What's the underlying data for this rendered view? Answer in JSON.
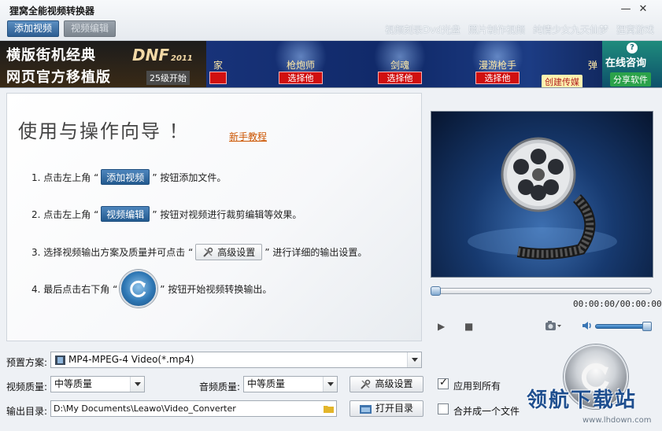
{
  "app": {
    "title": "狸窝全能视频转换器"
  },
  "window_controls": {
    "minimize": "—",
    "close": "✕"
  },
  "toolbar": {
    "add_video": "添加视频",
    "edit_video": "视频编辑"
  },
  "top_links": [
    "视频刻录Dvd光盘",
    "照片制作视频",
    "纯情少女九天仙梦",
    "狸窝游戏"
  ],
  "banner": {
    "line1": "横版街机经典",
    "line2": "网页官方移植版",
    "dnf": "DNF",
    "dnf_year": "2011",
    "level": "25级开始",
    "chars": [
      "家",
      "枪炮师",
      "剑魂",
      "漫游枪手",
      "弹"
    ],
    "pick": "选择他",
    "chuang": "创建传媒",
    "consult": "在线咨询",
    "share": "分享软件",
    "help": "?"
  },
  "wizard": {
    "title": "使用与操作向导 ！",
    "tutorial_link": "新手教程",
    "step1_pre": "1. 点击左上角 “",
    "step1_btn": "添加视频",
    "step1_post": "” 按钮添加文件。",
    "step2_pre": "2. 点击左上角 “",
    "step2_btn": "视频编辑",
    "step2_post": "” 按钮对视频进行裁剪编辑等效果。",
    "step3_pre": "3. 选择视频输出方案及质量并可点击 “",
    "step3_btn": "高级设置",
    "step3_post": "” 进行详细的输出设置。",
    "step4_pre": "4. 最后点击右下角 “",
    "step4_post": "” 按钮开始视频转换输出。"
  },
  "player": {
    "timecode": "00:00:00/00:00:00"
  },
  "settings": {
    "preset_label": "预置方案:",
    "preset_value": "MP4-MPEG-4 Video(*.mp4)",
    "video_quality_label": "视频质量:",
    "video_quality_value": "中等质量",
    "audio_quality_label": "音频质量:",
    "audio_quality_value": "中等质量",
    "advanced_button": "高级设置",
    "apply_all_label": "应用到所有",
    "output_dir_label": "输出目录:",
    "output_dir_value": "D:\\My Documents\\Leawo\\Video_Converter",
    "open_dir_button": "打开目录",
    "merge_label": "合并成一个文件"
  },
  "watermark": {
    "brand": "领航下载站",
    "url": "www.lhdown.com"
  },
  "colors": {
    "accent": "#2e5e92",
    "banner_red": "#d01010",
    "link": "#cc5500"
  }
}
